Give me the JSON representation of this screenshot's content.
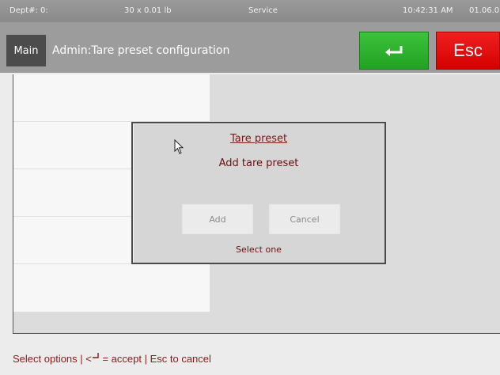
{
  "status_bar": {
    "dept": "Dept#: 0:",
    "weight": "30 x 0.01 lb",
    "mode": "Service",
    "time": "10:42:31 AM",
    "version": "01.06.0"
  },
  "header": {
    "main_tab": "Main",
    "title": "Admin:Tare preset configuration",
    "esc_label": "Esc",
    "accept_icon": "enter-return-icon"
  },
  "list": {
    "rows": [
      "",
      "",
      "",
      "",
      ""
    ]
  },
  "dialog": {
    "title": "Tare preset",
    "message": "Add tare preset",
    "add_label": "Add",
    "cancel_label": "Cancel",
    "hint": "Select one"
  },
  "footer": {
    "prefix": "Select options | <",
    "suffix": " = accept | Esc to cancel"
  },
  "colors": {
    "accept": "#22a222",
    "escape": "#d40000",
    "dialog_text": "#7a1a1a"
  }
}
